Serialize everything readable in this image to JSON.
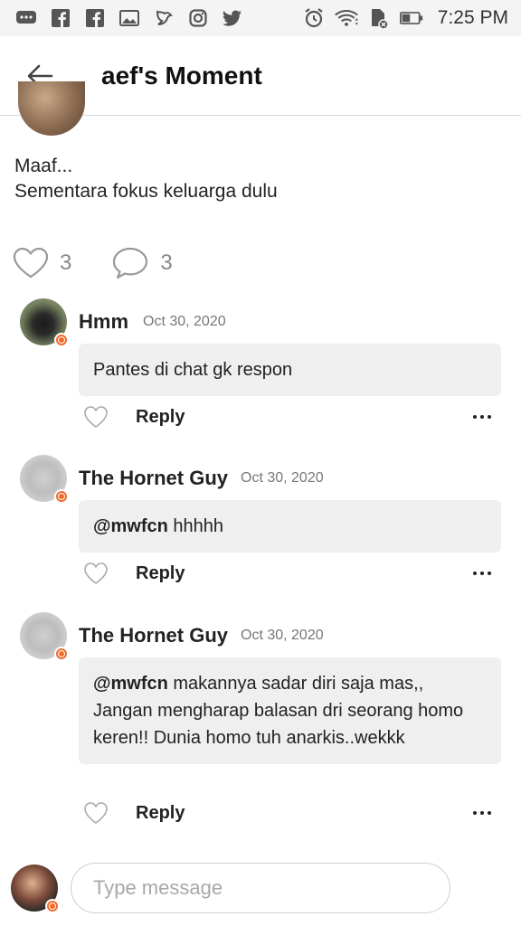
{
  "status_bar": {
    "time": "7:25 PM",
    "left_icons": [
      "message-icon",
      "facebook-icon",
      "facebook-icon",
      "gallery-icon",
      "bird-icon",
      "instagram-icon",
      "twitter-icon"
    ],
    "right_icons": [
      "alarm-icon",
      "wifi-icon",
      "sim-card-icon",
      "battery-icon"
    ]
  },
  "header": {
    "title": "aef's Moment"
  },
  "post": {
    "text_lines": [
      "Maaf...",
      "Sementara fokus keluarga dulu"
    ],
    "like_count": "3",
    "comment_count": "3"
  },
  "comments": [
    {
      "name": "Hmm",
      "date": "Oct 30, 2020",
      "mention": "",
      "text": "Pantes di chat gk respon",
      "reply_label": "Reply"
    },
    {
      "name": "The Hornet Guy",
      "date": "Oct 30, 2020",
      "mention": "@mwfcn",
      "text": " hhhhh",
      "reply_label": "Reply"
    },
    {
      "name": "The Hornet Guy",
      "date": "Oct 30, 2020",
      "mention": "@mwfcn",
      "text": " makannya sadar diri saja mas,, Jangan mengharap balasan dri seorang homo keren!! Dunia homo tuh anarkis..wekkk",
      "reply_label": "Reply"
    }
  ],
  "composer": {
    "placeholder": "Type message"
  },
  "colors": {
    "accent_badge": "#f06a2a",
    "bubble_bg": "#efefef"
  }
}
